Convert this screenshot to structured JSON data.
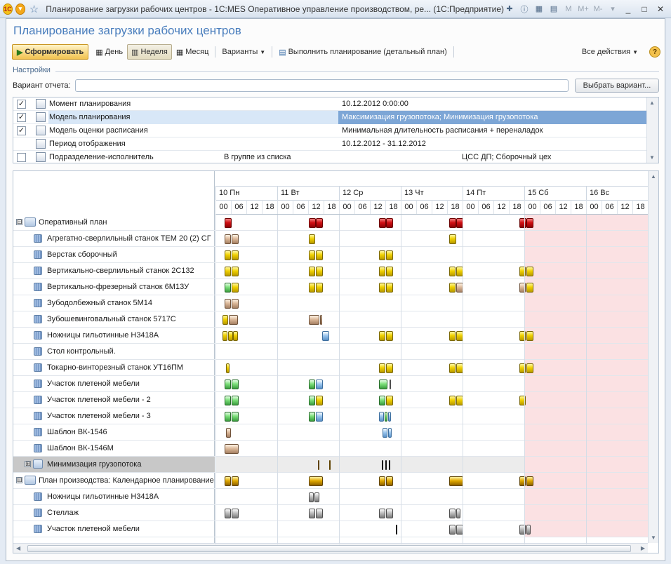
{
  "window": {
    "title": "Планирование загрузки рабочих центров - 1С:MES Оперативное управление производством, ре... (1С:Предприятие)",
    "logo": "1С",
    "buttons": {
      "minimize": "_",
      "maximize": "□",
      "close": "✕"
    }
  },
  "page": {
    "heading": "Планирование загрузки рабочих центров"
  },
  "toolbar": {
    "generate": "Сформировать",
    "day": "День",
    "week": "Неделя",
    "month": "Месяц",
    "variants": "Варианты",
    "run_planning": "Выполнить планирование (детальный план)",
    "all_actions": "Все действия",
    "help": "?"
  },
  "settings": {
    "group_label": "Настройки",
    "variant_label": "Вариант отчета:",
    "variant_value": "",
    "select_variant": "Выбрать вариант...",
    "rows": [
      {
        "checked": true,
        "name": "Момент планирования",
        "value": "10.12.2012 0:00:00",
        "extra": ""
      },
      {
        "checked": true,
        "name": "Модель планирования",
        "value": "Максимизация грузопотока; Минимизация грузопотока",
        "extra": "",
        "selected": true
      },
      {
        "checked": true,
        "name": "Модель оценки расписания",
        "value": "Минимальная длительность расписания + переналадок",
        "extra": ""
      },
      {
        "checked": null,
        "name": "Период отображения",
        "value": "10.12.2012 - 31.12.2012",
        "extra": ""
      },
      {
        "checked": false,
        "name": "Подразделение-исполнитель",
        "value": "В группе из списка",
        "extra": "ЦСС ДП; Сборочный цех"
      }
    ]
  },
  "timeline": {
    "days": [
      {
        "label": "10 Пн",
        "weekend": false
      },
      {
        "label": "11 Вт",
        "weekend": false
      },
      {
        "label": "12 Ср",
        "weekend": false
      },
      {
        "label": "13 Чт",
        "weekend": false
      },
      {
        "label": "14 Пт",
        "weekend": false
      },
      {
        "label": "15 Сб",
        "weekend": true
      },
      {
        "label": "16 Вс",
        "weekend": true
      }
    ],
    "hours": [
      "00",
      "06",
      "12",
      "18"
    ],
    "colors": {
      "red": "#d10e12",
      "yellow": "#f0d000",
      "green": "#7cdf7a",
      "blue": "#9cc7ee",
      "tan": "#dcb99a",
      "gold": "#e0a800",
      "grey": "#bdbdbd",
      "weekend": "#fbe1e3"
    },
    "rows": [
      {
        "label": "Оперативный план",
        "kind": "group",
        "expander": "⊟",
        "bars": [
          [
            1.25,
            2.25,
            "red"
          ],
          [
            1.25,
            2.25,
            "red"
          ],
          [
            13.25,
            14.25,
            "red"
          ],
          [
            14.25,
            15.25,
            "red"
          ],
          [
            23.25,
            24.25,
            "red"
          ],
          [
            24.25,
            25.25,
            "red"
          ],
          [
            33.25,
            34.25,
            "red"
          ],
          [
            34.25,
            35.25,
            "red"
          ],
          [
            43.25,
            44.25,
            "red"
          ],
          [
            44.25,
            45.25,
            "red"
          ]
        ]
      },
      {
        "label": "Агрегатно-сверлильный станок  ТЕМ 20 (2) СГ",
        "kind": "item",
        "bars": [
          [
            1.25,
            2.2,
            "tan"
          ],
          [
            2.3,
            3.25,
            "tan"
          ],
          [
            13.25,
            14.2,
            "yellow"
          ],
          [
            33.25,
            34.25,
            "yellow"
          ]
        ]
      },
      {
        "label": "Верстак сборочный",
        "kind": "item",
        "bars": [
          [
            1.25,
            2.2,
            "yellow"
          ],
          [
            2.3,
            3.25,
            "yellow"
          ],
          [
            13.25,
            14.2,
            "yellow"
          ],
          [
            14.3,
            15.25,
            "yellow"
          ],
          [
            23.25,
            24.2,
            "yellow"
          ],
          [
            24.3,
            25.25,
            "yellow"
          ]
        ]
      },
      {
        "label": "Вертикально-сверлильный станок 2С132",
        "kind": "item",
        "bars": [
          [
            1.25,
            2.2,
            "yellow"
          ],
          [
            2.3,
            3.25,
            "yellow"
          ],
          [
            13.25,
            14.2,
            "yellow"
          ],
          [
            14.3,
            15.25,
            "yellow"
          ],
          [
            23.25,
            24.2,
            "yellow"
          ],
          [
            24.3,
            25.25,
            "yellow"
          ],
          [
            33.25,
            34.2,
            "yellow"
          ],
          [
            34.3,
            35.25,
            "yellow"
          ],
          [
            43.25,
            44.2,
            "yellow"
          ],
          [
            44.3,
            45.25,
            "yellow"
          ]
        ]
      },
      {
        "label": "Вертикально-фрезерный станок 6М13У",
        "kind": "item",
        "bars": [
          [
            1.25,
            2.2,
            "green"
          ],
          [
            2.3,
            3.25,
            "yellow"
          ],
          [
            13.25,
            14.2,
            "yellow"
          ],
          [
            14.3,
            15.25,
            "yellow"
          ],
          [
            23.25,
            24.2,
            "yellow"
          ],
          [
            24.3,
            25.25,
            "yellow"
          ],
          [
            33.25,
            34.2,
            "yellow"
          ],
          [
            34.3,
            35.25,
            "tan"
          ],
          [
            43.25,
            44.2,
            "tan"
          ],
          [
            44.3,
            45.25,
            "yellow"
          ]
        ]
      },
      {
        "label": "Зубодолбежный станок 5М14",
        "kind": "item",
        "bars": [
          [
            1.25,
            2.2,
            "tan"
          ],
          [
            2.3,
            3.25,
            "tan"
          ]
        ]
      },
      {
        "label": "Зубошевинговальный станок 5717С",
        "kind": "item",
        "bars": [
          [
            1.0,
            1.8,
            "yellow"
          ],
          [
            1.9,
            3.2,
            "tan"
          ],
          [
            13.25,
            14.75,
            "tan"
          ],
          [
            14.85,
            15.2,
            "tan"
          ]
        ]
      },
      {
        "label": "Ножницы гильотинные Н3418А",
        "kind": "item",
        "bars": [
          [
            1.0,
            1.7,
            "yellow"
          ],
          [
            1.75,
            2.45,
            "yellow"
          ],
          [
            2.5,
            3.2,
            "yellow"
          ],
          [
            15.2,
            16.2,
            "blue"
          ],
          [
            23.25,
            24.2,
            "yellow"
          ],
          [
            24.3,
            25.25,
            "yellow"
          ],
          [
            33.25,
            34.2,
            "yellow"
          ],
          [
            34.3,
            35.25,
            "yellow"
          ],
          [
            43.25,
            44.2,
            "yellow"
          ],
          [
            44.3,
            45.25,
            "yellow"
          ]
        ]
      },
      {
        "label": "Стол контрольный.",
        "kind": "item",
        "bars": []
      },
      {
        "label": "Токарно-винторезный станок УТ16ПМ",
        "kind": "item",
        "bars": [
          [
            1.5,
            2.0,
            "yellow"
          ],
          [
            23.25,
            24.2,
            "yellow"
          ],
          [
            24.3,
            25.25,
            "yellow"
          ],
          [
            33.25,
            34.2,
            "yellow"
          ],
          [
            34.3,
            35.25,
            "yellow"
          ],
          [
            43.25,
            44.2,
            "yellow"
          ],
          [
            44.3,
            45.25,
            "yellow"
          ]
        ]
      },
      {
        "label": "Участок плетеной мебели",
        "kind": "item",
        "bars": [
          [
            1.25,
            2.2,
            "green"
          ],
          [
            2.3,
            3.25,
            "green"
          ],
          [
            13.25,
            14.2,
            "green"
          ],
          [
            14.3,
            15.25,
            "blue"
          ],
          [
            23.25,
            24.5,
            "green"
          ],
          [
            24.75,
            24.95,
            "grey"
          ]
        ]
      },
      {
        "label": "Участок плетеной мебели - 2",
        "kind": "item",
        "bars": [
          [
            1.25,
            2.2,
            "green"
          ],
          [
            2.3,
            3.25,
            "green"
          ],
          [
            13.25,
            14.2,
            "green"
          ],
          [
            14.3,
            15.25,
            "yellow"
          ],
          [
            23.25,
            24.2,
            "green"
          ],
          [
            24.3,
            25.25,
            "yellow"
          ],
          [
            33.25,
            34.2,
            "yellow"
          ],
          [
            34.3,
            35.25,
            "yellow"
          ],
          [
            43.25,
            44.2,
            "yellow"
          ]
        ]
      },
      {
        "label": "Участок плетеной мебели - 3",
        "kind": "item",
        "bars": [
          [
            1.25,
            2.2,
            "green"
          ],
          [
            2.3,
            3.25,
            "green"
          ],
          [
            13.25,
            14.2,
            "green"
          ],
          [
            14.3,
            15.25,
            "blue"
          ],
          [
            23.25,
            24.0,
            "blue"
          ],
          [
            24.1,
            24.5,
            "green"
          ],
          [
            24.6,
            25.0,
            "blue"
          ]
        ]
      },
      {
        "label": "Шаблон ВК-1546",
        "kind": "item",
        "bars": [
          [
            1.5,
            2.2,
            "tan"
          ],
          [
            23.75,
            24.5,
            "blue"
          ],
          [
            24.6,
            25.1,
            "blue"
          ]
        ]
      },
      {
        "label": "Шаблон ВК-1546М",
        "kind": "item",
        "bars": [
          [
            1.25,
            3.25,
            "tan"
          ]
        ]
      },
      {
        "label": "Минимизация грузопотока",
        "kind": "subgroup",
        "expander": "⊞",
        "bars": [
          [
            14.6,
            14.8,
            "gold"
          ],
          [
            16.2,
            16.4,
            "gold"
          ],
          [
            23.7,
            23.9,
            "blk"
          ],
          [
            24.2,
            24.4,
            "blk"
          ],
          [
            24.7,
            24.9,
            "blk"
          ]
        ]
      },
      {
        "label": "План производства: Календарное планирование",
        "kind": "group",
        "expander": "⊟",
        "bars": [
          [
            1.25,
            2.2,
            "gold"
          ],
          [
            2.3,
            3.25,
            "gold"
          ],
          [
            13.25,
            15.25,
            "gold"
          ],
          [
            23.25,
            24.2,
            "gold"
          ],
          [
            24.3,
            25.25,
            "gold"
          ],
          [
            33.25,
            35.25,
            "gold"
          ],
          [
            43.25,
            44.2,
            "gold"
          ],
          [
            44.3,
            45.25,
            "gold"
          ]
        ]
      },
      {
        "label": "Ножницы гильотинные Н3418А",
        "kind": "item",
        "bars": [
          [
            13.25,
            14.0,
            "grey"
          ],
          [
            14.05,
            14.8,
            "grey"
          ]
        ]
      },
      {
        "label": "Стеллаж",
        "kind": "item",
        "bars": [
          [
            1.25,
            2.2,
            "grey"
          ],
          [
            2.3,
            3.25,
            "grey"
          ],
          [
            13.25,
            14.2,
            "grey"
          ],
          [
            14.3,
            15.25,
            "grey"
          ],
          [
            23.25,
            24.2,
            "grey"
          ],
          [
            24.3,
            25.25,
            "grey"
          ],
          [
            33.25,
            34.2,
            "grey"
          ],
          [
            34.3,
            34.85,
            "grey"
          ]
        ]
      },
      {
        "label": "Участок плетеной мебели",
        "kind": "item",
        "bars": [
          [
            25.7,
            25.8,
            "blk"
          ],
          [
            33.25,
            34.2,
            "grey"
          ],
          [
            34.3,
            35.25,
            "grey"
          ],
          [
            43.25,
            44.2,
            "grey"
          ],
          [
            44.3,
            44.9,
            "grey"
          ]
        ]
      }
    ]
  }
}
